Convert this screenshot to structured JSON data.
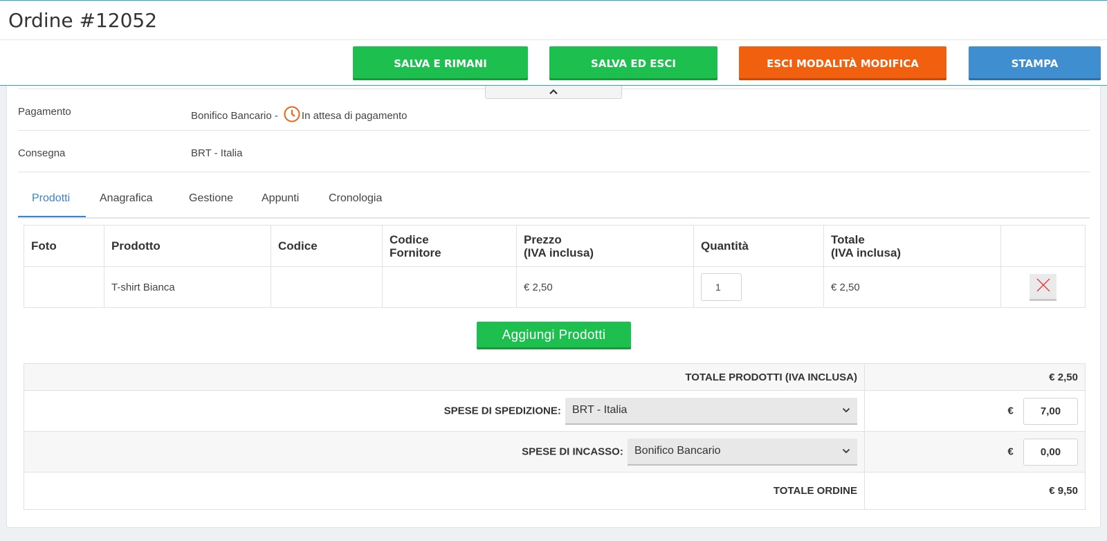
{
  "header": {
    "title": "Ordine #12052"
  },
  "actions": {
    "save_stay": "SALVA E RIMANI",
    "save_exit": "SALVA ED ESCI",
    "exit_edit": "ESCI MODALITÀ MODIFICA",
    "print": "STAMPA",
    "colors": {
      "green": "#1dbf4f",
      "orange": "#f1600f",
      "blue": "#3f8ed0"
    }
  },
  "info": {
    "payment": {
      "label": "Pagamento",
      "method": "Bonifico Bancario -",
      "status": "In attesa di pagamento",
      "status_icon": "clock-icon"
    },
    "delivery": {
      "label": "Consegna",
      "value": "BRT - Italia"
    }
  },
  "tabs": [
    {
      "label": "Prodotti",
      "active": true
    },
    {
      "label": "Anagrafica"
    },
    {
      "label": "Gestione"
    },
    {
      "label": "Appunti"
    },
    {
      "label": "Cronologia"
    }
  ],
  "products_table": {
    "headers": [
      "Foto",
      "Prodotto",
      "Codice",
      "Codice\nFornitore",
      "Prezzo\n(IVA inclusa)",
      "Quantità",
      "Totale\n(IVA inclusa)",
      ""
    ],
    "rows": [
      {
        "photo": "",
        "product": "T-shirt Bianca",
        "code": "",
        "supplier_code": "",
        "price": "€ 2,50",
        "quantity": "1",
        "total": "€ 2,50"
      }
    ]
  },
  "add_products": "Aggiungi Prodotti",
  "totals": {
    "products_label": "TOTALE PRODOTTI (IVA INCLUSA)",
    "products_value": "€ 2,50",
    "shipping_label": "SPESE DI SPEDIZIONE:",
    "shipping_option": "BRT - Italia",
    "shipping_currency": "€",
    "shipping_value": "7,00",
    "cod_label": "SPESE DI INCASSO:",
    "cod_option": "Bonifico Bancario",
    "cod_currency": "€",
    "cod_value": "0,00",
    "order_label": "TOTALE ORDINE",
    "order_value": "€ 9,50"
  }
}
